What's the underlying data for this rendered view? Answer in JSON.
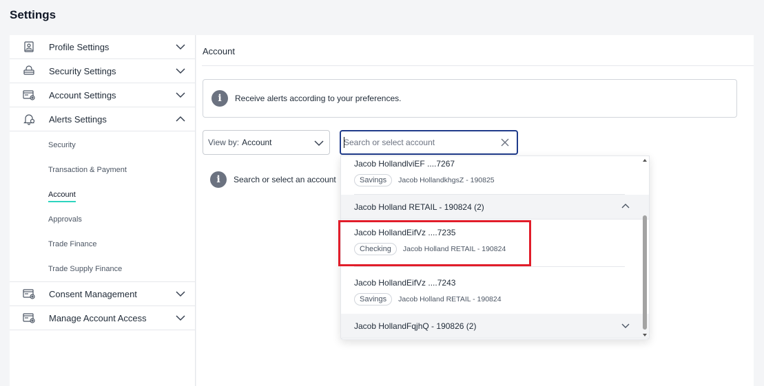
{
  "page": {
    "title": "Settings"
  },
  "sidebar": {
    "items": [
      {
        "label": "Profile Settings",
        "icon": "profile-icon",
        "expanded": false
      },
      {
        "label": "Security Settings",
        "icon": "lock-icon",
        "expanded": false
      },
      {
        "label": "Account Settings",
        "icon": "account-card-icon",
        "expanded": false
      },
      {
        "label": "Alerts Settings",
        "icon": "bell-icon",
        "expanded": true
      },
      {
        "label": "Consent Management",
        "icon": "consent-card-icon",
        "expanded": false
      },
      {
        "label": "Manage Account Access",
        "icon": "access-card-icon",
        "expanded": false
      }
    ],
    "alerts_sub": [
      "Security",
      "Transaction & Payment",
      "Account",
      "Approvals",
      "Trade Finance",
      "Trade Supply Finance"
    ],
    "alerts_active": "Account"
  },
  "main": {
    "title": "Account",
    "info": "Receive alerts according to your preferences.",
    "view_by": {
      "label": "View by:",
      "value": "Account"
    },
    "search": {
      "placeholder": "Search or select account",
      "value": ""
    },
    "empty_message": "Search or select an account"
  },
  "dropdown": {
    "partial_account": {
      "name": "Jacob HollandlviEF ....7267",
      "type": "Savings",
      "owner": "Jacob HollandkhgsZ - 190825"
    },
    "groups": [
      {
        "label": "Jacob Holland RETAIL - 190824 (2)",
        "expanded": true,
        "accounts": [
          {
            "name": "Jacob HollandEifVz ....7235",
            "type": "Checking",
            "owner": "Jacob Holland RETAIL - 190824"
          },
          {
            "name": "Jacob HollandEifVz ....7243",
            "type": "Savings",
            "owner": "Jacob Holland RETAIL - 190824"
          }
        ]
      },
      {
        "label": "Jacob HollandFqjhQ - 190826 (2)",
        "expanded": false
      }
    ]
  },
  "colors": {
    "accent_underline": "#2dd4bf",
    "search_border": "#1e3a8a",
    "highlight": "#e11d2a",
    "info_icon": "#6b7280"
  }
}
